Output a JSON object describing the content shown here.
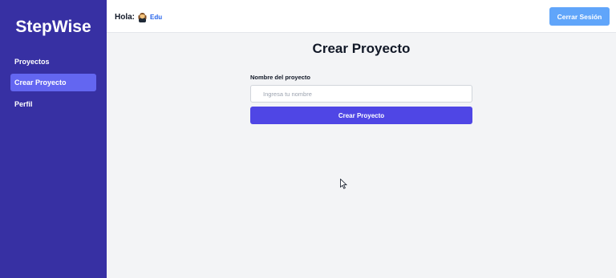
{
  "sidebar": {
    "brand": "StepWise",
    "items": [
      {
        "label": "Proyectos",
        "active": false
      },
      {
        "label": "Crear Proyecto",
        "active": true
      },
      {
        "label": "Perfil",
        "active": false
      }
    ]
  },
  "header": {
    "greeting": "Hola:",
    "avatar_icon": "user-avatar-icon",
    "username": "Edu",
    "logout_label": "Cerrar Sesión"
  },
  "main": {
    "title": "Crear Proyecto",
    "field_label": "Nombre del proyecto",
    "input_value": "",
    "input_placeholder": "Ingresa tu nombre",
    "submit_label": "Crear Proyecto"
  },
  "colors": {
    "sidebar_bg": "#3730a3",
    "sidebar_active": "#6366f1",
    "primary_button": "#4f46e5",
    "logout_button": "#60a5fa",
    "username": "#2563eb"
  }
}
